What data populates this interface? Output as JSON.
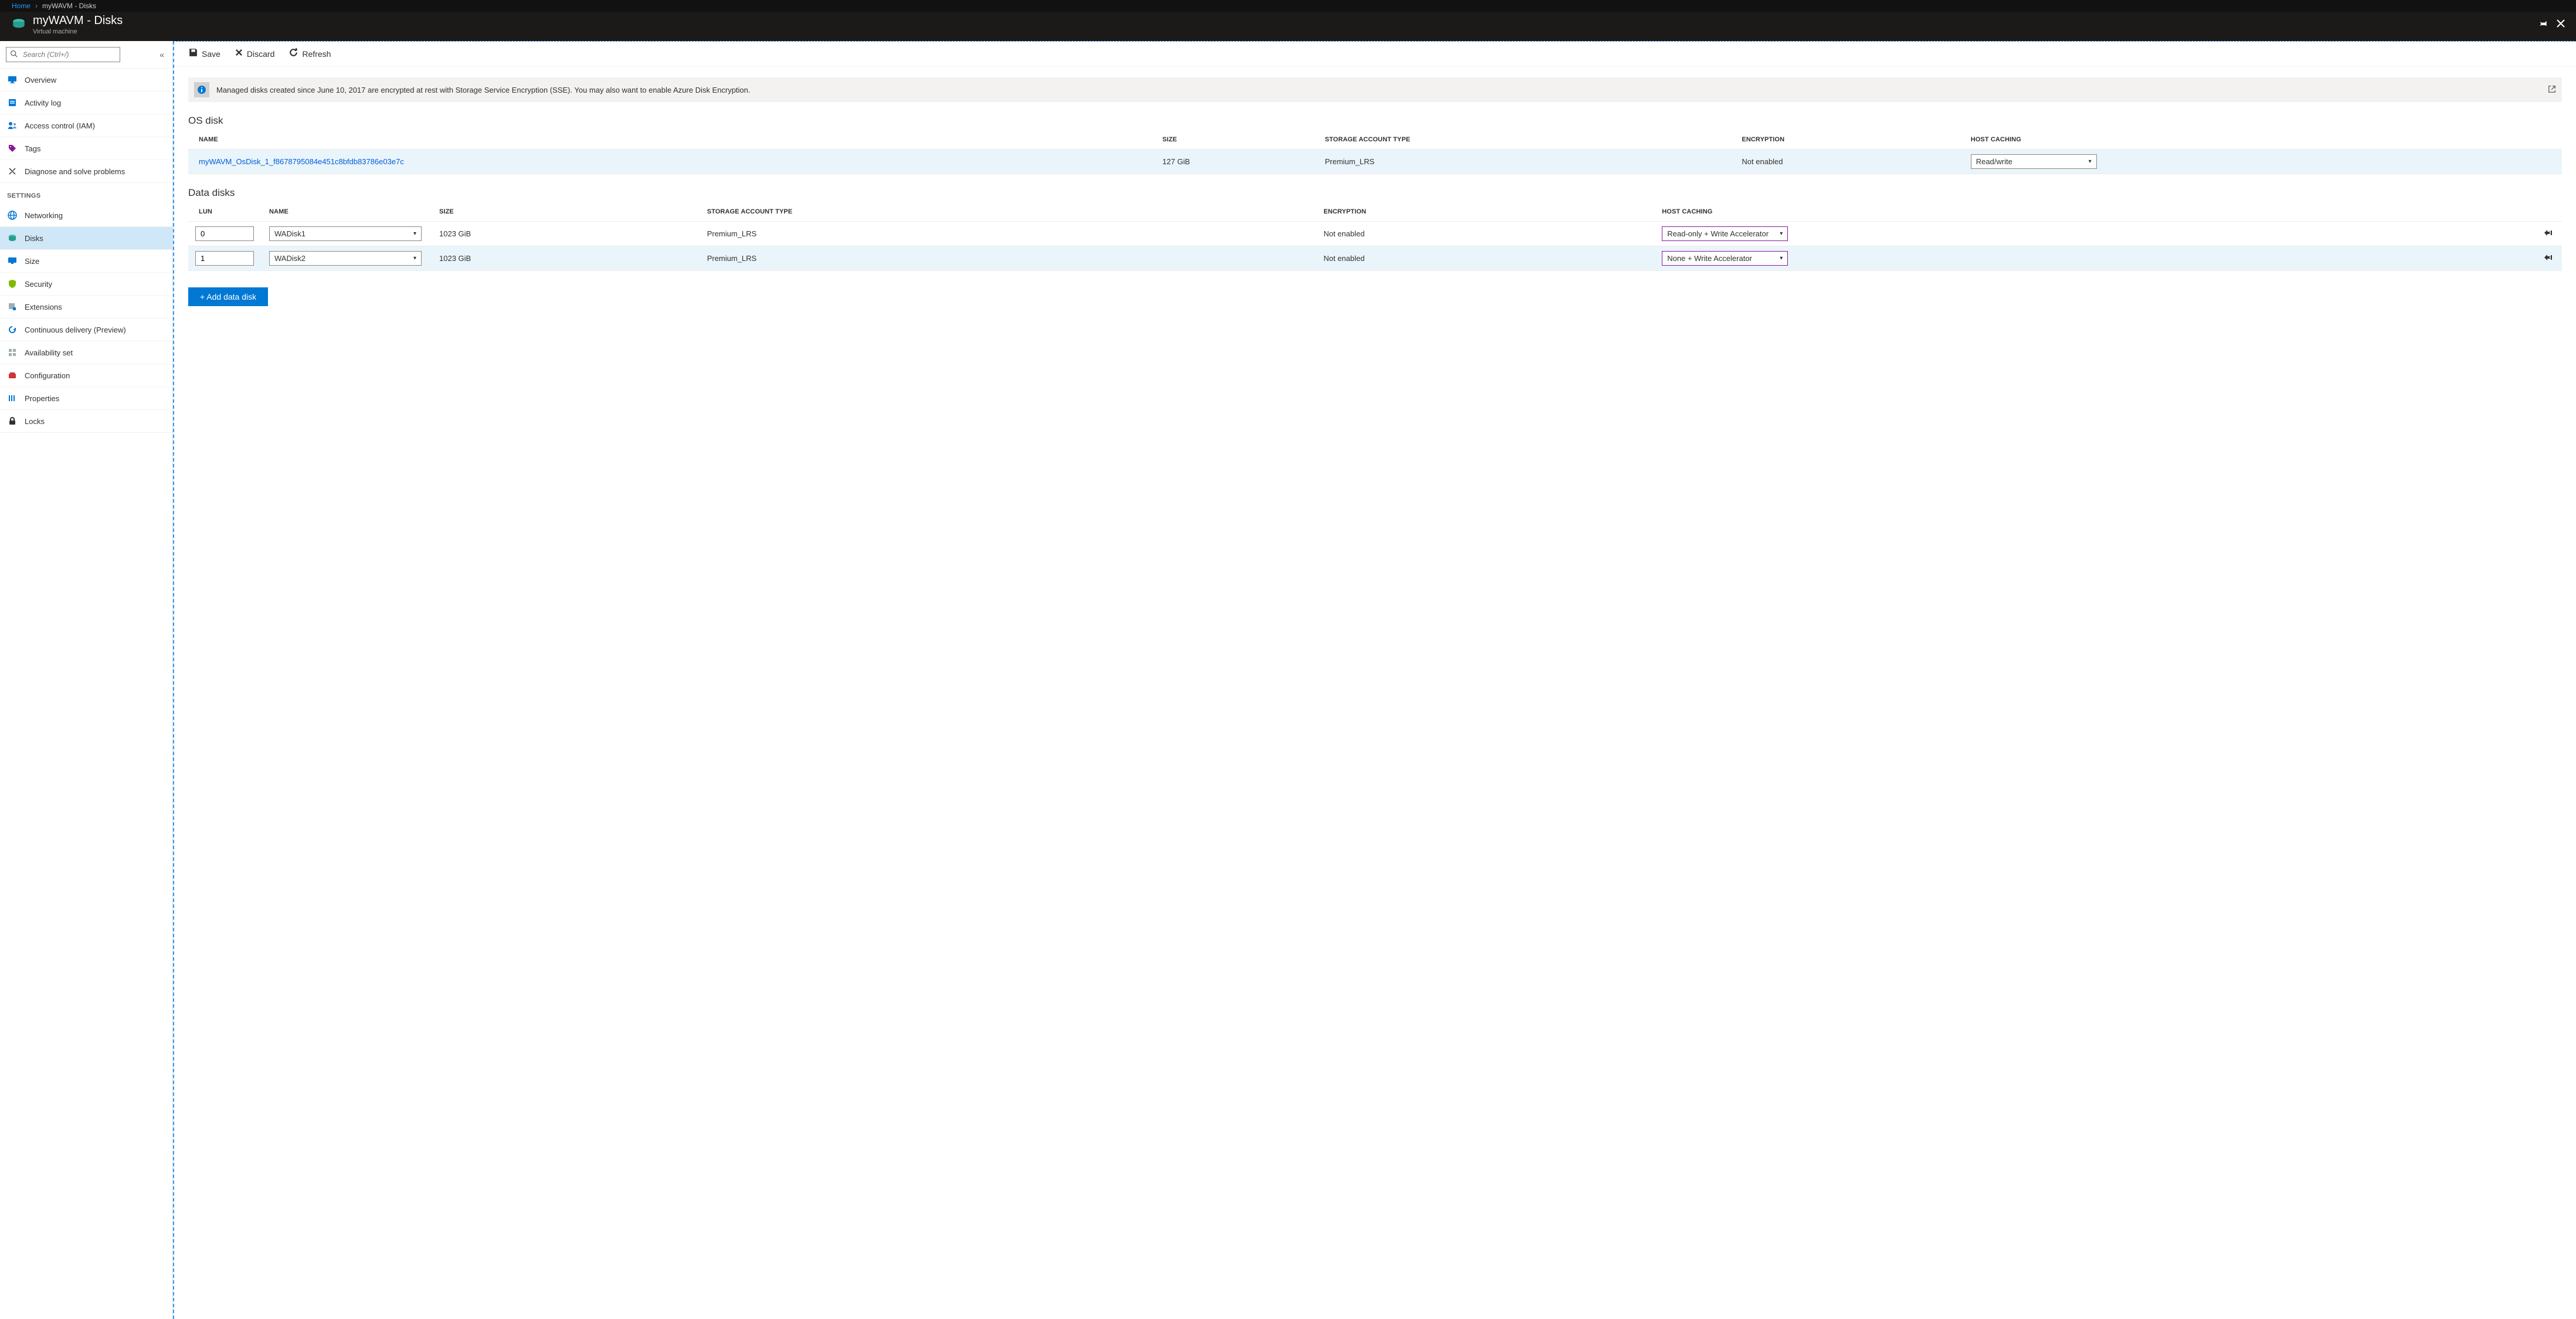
{
  "breadcrumb": {
    "home": "Home",
    "current": "myWAVM - Disks"
  },
  "header": {
    "title": "myWAVM - Disks",
    "subtitle": "Virtual machine"
  },
  "sidebar": {
    "search_placeholder": "Search (Ctrl+/)",
    "items": [
      {
        "label": "Overview"
      },
      {
        "label": "Activity log"
      },
      {
        "label": "Access control (IAM)"
      },
      {
        "label": "Tags"
      },
      {
        "label": "Diagnose and solve problems"
      }
    ],
    "settings_heading": "SETTINGS",
    "settings": [
      {
        "label": "Networking"
      },
      {
        "label": "Disks"
      },
      {
        "label": "Size"
      },
      {
        "label": "Security"
      },
      {
        "label": "Extensions"
      },
      {
        "label": "Continuous delivery (Preview)"
      },
      {
        "label": "Availability set"
      },
      {
        "label": "Configuration"
      },
      {
        "label": "Properties"
      },
      {
        "label": "Locks"
      }
    ]
  },
  "toolbar": {
    "save": "Save",
    "discard": "Discard",
    "refresh": "Refresh"
  },
  "info": "Managed disks created since June 10, 2017 are encrypted at rest with Storage Service Encryption (SSE). You may also want to enable Azure Disk Encryption.",
  "os_section": "OS disk",
  "data_section": "Data disks",
  "columns_os": {
    "name": "NAME",
    "size": "SIZE",
    "sat": "STORAGE ACCOUNT TYPE",
    "enc": "ENCRYPTION",
    "hc": "HOST CACHING"
  },
  "columns_data": {
    "lun": "LUN",
    "name": "NAME",
    "size": "SIZE",
    "sat": "STORAGE ACCOUNT TYPE",
    "enc": "ENCRYPTION",
    "hc": "HOST CACHING"
  },
  "os_disk": {
    "name": "myWAVM_OsDisk_1_f8678795084e451c8bfdb83786e03e7c",
    "size": "127 GiB",
    "sat": "Premium_LRS",
    "enc": "Not enabled",
    "hc": "Read/write"
  },
  "data_disks": [
    {
      "lun": "0",
      "name": "WADisk1",
      "size": "1023 GiB",
      "sat": "Premium_LRS",
      "enc": "Not enabled",
      "hc": "Read-only + Write Accelerator"
    },
    {
      "lun": "1",
      "name": "WADisk2",
      "size": "1023 GiB",
      "sat": "Premium_LRS",
      "enc": "Not enabled",
      "hc": "None + Write Accelerator"
    }
  ],
  "add_button": "+ Add data disk"
}
